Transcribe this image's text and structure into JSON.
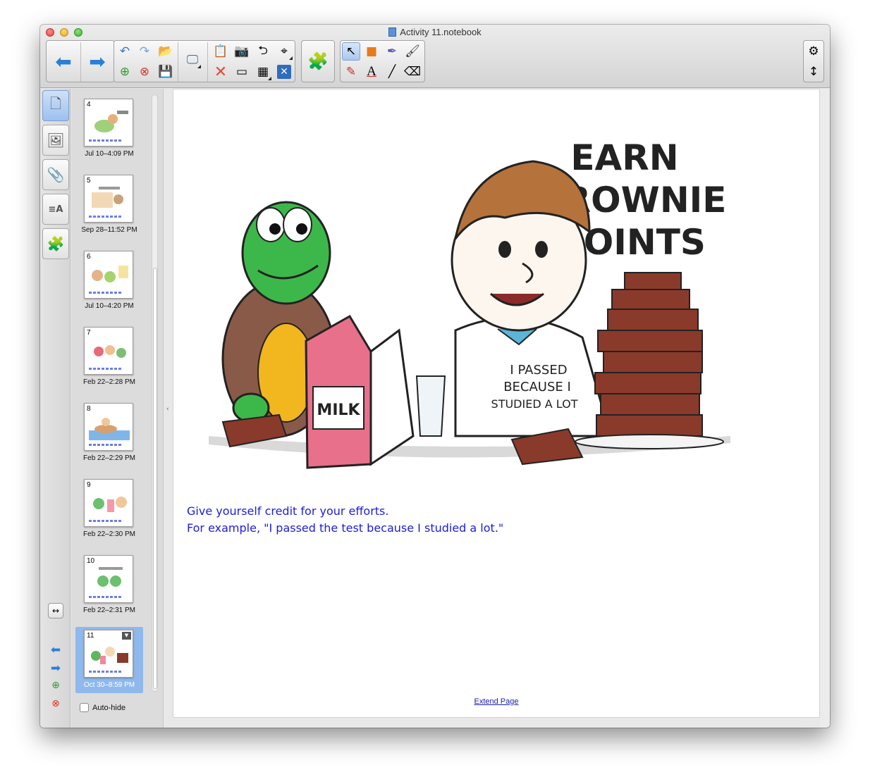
{
  "window": {
    "title": "Activity 11.notebook"
  },
  "sorter": {
    "pages": [
      {
        "number": "4",
        "date": "Jul 10–4:09 PM"
      },
      {
        "number": "5",
        "date": "Sep 28–11:52 PM"
      },
      {
        "number": "6",
        "date": "Jul 10–4:20 PM"
      },
      {
        "number": "7",
        "date": "Feb 22–2:28 PM"
      },
      {
        "number": "8",
        "date": "Feb 22–2:29 PM"
      },
      {
        "number": "9",
        "date": "Feb 22–2:30 PM"
      },
      {
        "number": "10",
        "date": "Feb 22–2:31 PM"
      },
      {
        "number": "11",
        "date": "Oct 30–8:59 PM",
        "selected": true
      }
    ],
    "autohide_label": "Auto-hide"
  },
  "page": {
    "image_text": {
      "headline_line1": "EARN",
      "headline_line2": "BROWNIE",
      "headline_line3": "POINTS",
      "carton_label": "MILK",
      "shirt_line1": "I PASSED",
      "shirt_line2": "BECAUSE I",
      "shirt_line3": "STUDIED A LOT"
    },
    "caption_line1": "Give yourself credit for your efforts.",
    "caption_line2": "For example, \"I passed the test because I studied a lot.\"",
    "extend_link": "Extend Page"
  },
  "colors": {
    "caption": "#1c1ce0",
    "selection": "#8fb9ec",
    "turtle": "#3cb84a",
    "carton": "#e8708a",
    "brownie": "#8a3a2a",
    "hair": "#b5723a"
  }
}
